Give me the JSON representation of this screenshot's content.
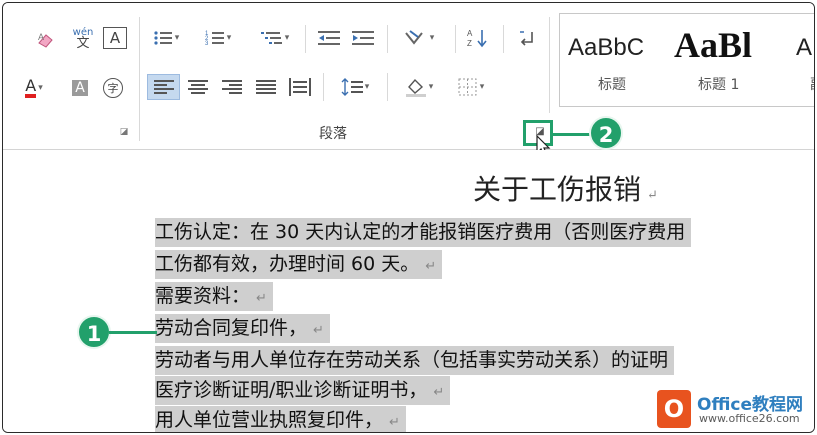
{
  "ribbon": {
    "group_label": "段落",
    "phonetic_top": "wén",
    "phonetic_bottom": "文",
    "char_border": "A",
    "font_color": "A",
    "char_shading": "A",
    "enclose_char": "字",
    "styles": [
      {
        "sample": "AaBbC",
        "name": "标题"
      },
      {
        "sample": "AaBl",
        "name": "标题 1"
      },
      {
        "sample": "A",
        "name": "副"
      }
    ]
  },
  "document": {
    "title": "关于工伤报销",
    "paragraph_mark": "↵",
    "lines": [
      "工伤认定：在 30 天内认定的才能报销医疗费用（否则医疗费用",
      "工伤都有效，办理时间 60 天。",
      "需要资料：",
      "劳动合同复印件，",
      "劳动者与用人单位存在劳动关系（包括事实劳动关系）的证明",
      "医疗诊断证明/职业诊断证明书，",
      "用人单位营业执照复印件，"
    ]
  },
  "callouts": {
    "one": "1",
    "two": "2",
    "color": "#22a06b"
  },
  "watermark": {
    "logo": "O",
    "title": "Office教程网",
    "url": "www.office26.com"
  }
}
